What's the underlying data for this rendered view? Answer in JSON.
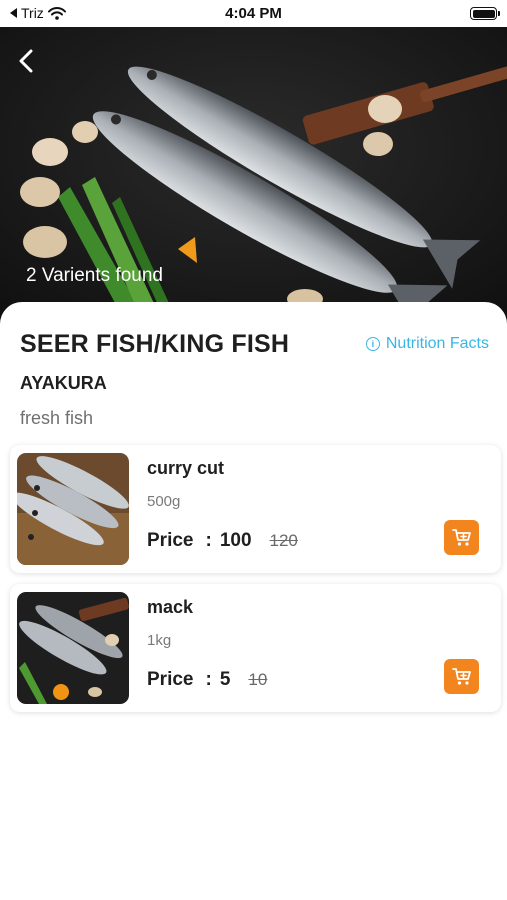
{
  "status_bar": {
    "carrier": "Triz",
    "time": "4:04 PM",
    "battery_level": 1.0
  },
  "hero": {
    "variants_found": "2 Varients found"
  },
  "product": {
    "title": "SEER FISH/KING FISH",
    "nutrition_link": "Nutrition Facts",
    "brand": "AYAKURA",
    "description": "fresh fish"
  },
  "variants": [
    {
      "name": "curry cut",
      "weight": "500g",
      "price_label": "Price",
      "separator": ":",
      "price": "100",
      "old_price": "120"
    },
    {
      "name": "mack",
      "weight": "1kg",
      "price_label": "Price",
      "separator": ":",
      "price": "5",
      "old_price": "10"
    }
  ],
  "colors": {
    "accent_orange": "#f3851f",
    "link_blue": "#39b6e6",
    "hero_background": "#161616"
  },
  "icons": {
    "back": "chevron-left-icon",
    "info": "info-icon",
    "cart": "cart-icon",
    "wifi": "wifi-icon",
    "battery": "battery-icon"
  }
}
